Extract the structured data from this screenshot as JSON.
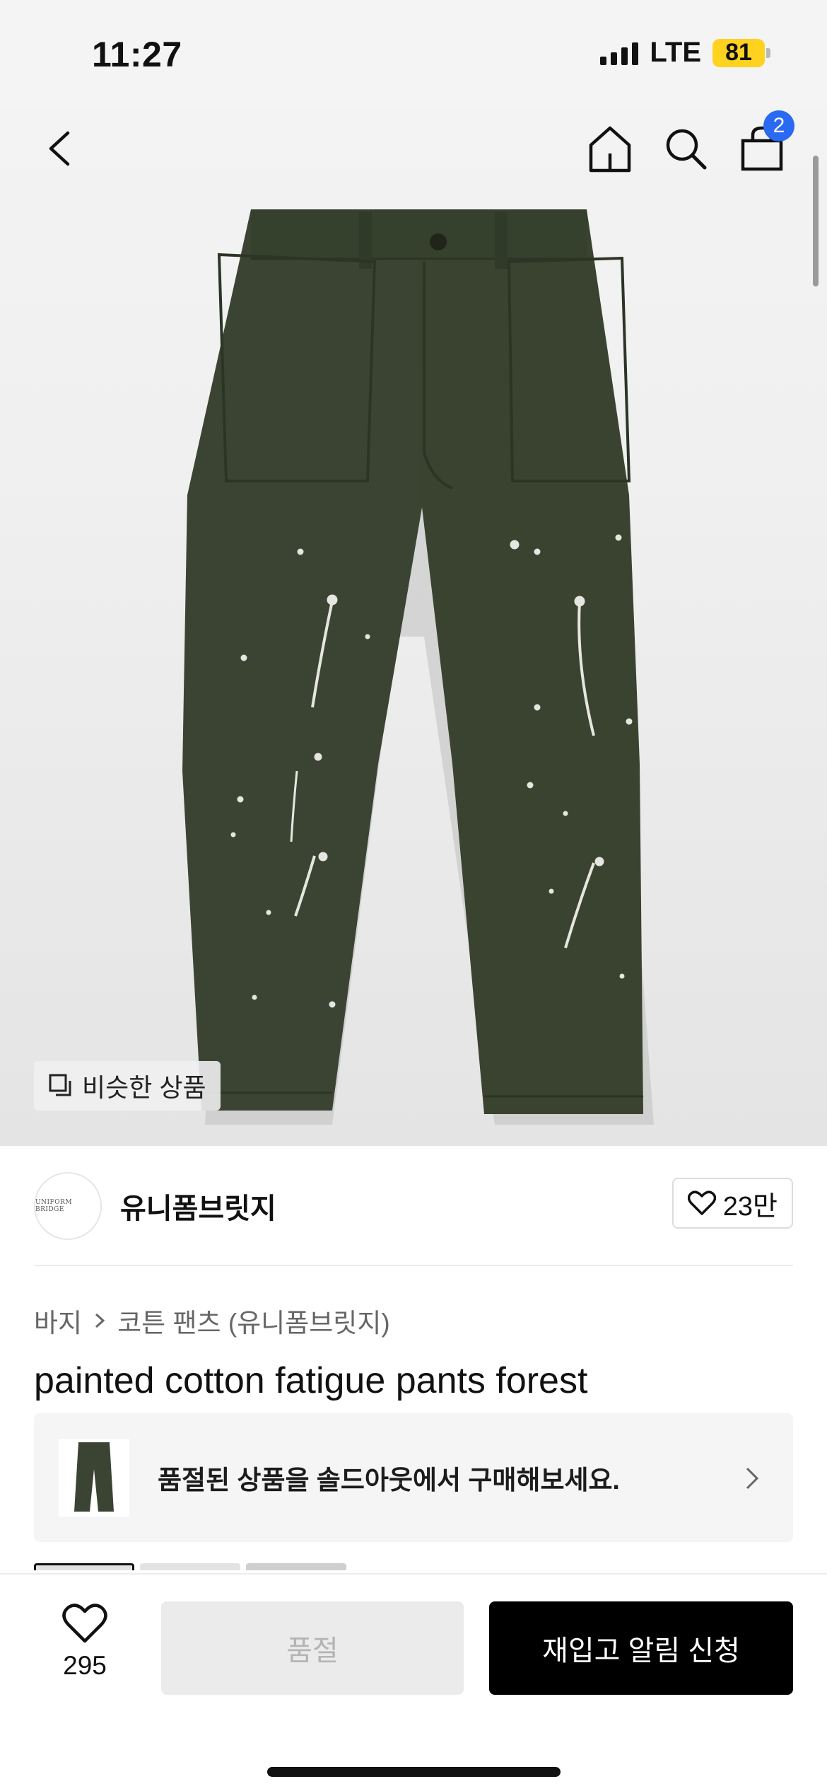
{
  "status_bar": {
    "time": "11:27",
    "network": "LTE",
    "battery": "81"
  },
  "header": {
    "cart_badge": "2"
  },
  "hero": {
    "similar_label": "비슷한 상품"
  },
  "brand": {
    "logo_text": "UNIFORM BRIDGE",
    "name": "유니폼브릿지",
    "likes": "23만"
  },
  "breadcrumb": {
    "category": "바지",
    "subcategory": "코튼 팬츠 (유니폼브릿지)"
  },
  "product": {
    "title": "painted cotton fatigue pants forest"
  },
  "soldout_banner": {
    "text": "품절된 상품을 솔드아웃에서 구매해보세요."
  },
  "bottom_bar": {
    "wish_count": "295",
    "soldout_label": "품절",
    "restock_label": "재입고 알림 신청"
  },
  "colors": {
    "pants": "#3b4433",
    "accent": "#2a6af2",
    "battery": "#ffd21f"
  }
}
